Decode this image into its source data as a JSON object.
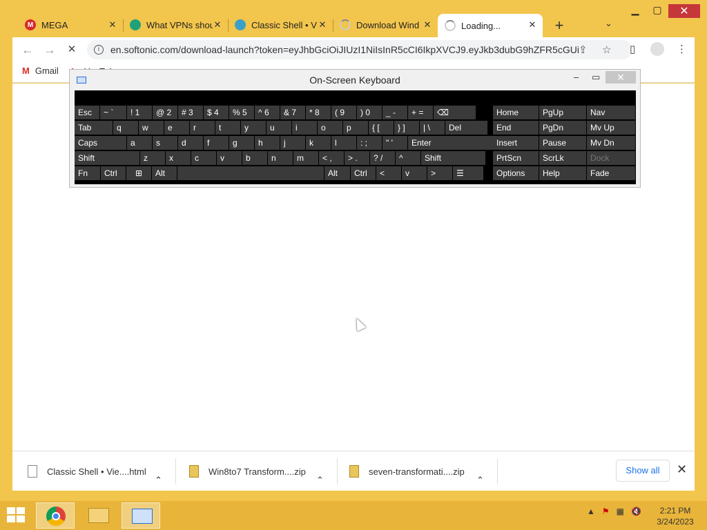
{
  "tabs": [
    {
      "title": "MEGA",
      "favicon": "mega-icon",
      "color": "#d9272e",
      "active": false
    },
    {
      "title": "What VPNs shou",
      "favicon": "vpn-icon",
      "color": "#1fa27a",
      "active": false
    },
    {
      "title": "Classic Shell • V",
      "favicon": "classic-shell-icon",
      "color": "#3aa0c8",
      "active": false
    },
    {
      "title": "Download Wind",
      "favicon": "loading-icon",
      "color": "#bbbbbb",
      "active": false
    },
    {
      "title": "Loading...",
      "favicon": "loading-icon",
      "color": "#bbbbbb",
      "active": true
    }
  ],
  "toolbar": {
    "url": "en.softonic.com/download-launch?token=eyJhbGciOiJIUzI1NiIsInR5cCI6IkpXVCJ9.eyJkb3dubG9hZFR5cGUi...",
    "back_glyph": "←",
    "forward_glyph": "→",
    "stop_glyph": "✕"
  },
  "bookmarks": [
    {
      "label": "Gmail",
      "icon": "gmail-icon"
    },
    {
      "label": "YouTube",
      "icon": "youtube-icon"
    }
  ],
  "osk": {
    "title": "On-Screen Keyboard",
    "rows": [
      [
        "Esc",
        "~ `",
        "! 1",
        "@ 2",
        "# 3",
        "$ 4",
        "% 5",
        "^ 6",
        "& 7",
        "* 8",
        "( 9",
        ") 0",
        "_ -",
        "+ =",
        "⌫"
      ],
      [
        "Tab",
        "q",
        "w",
        "e",
        "r",
        "t",
        "y",
        "u",
        "i",
        "o",
        "p",
        "{ [",
        "} ]",
        "| \\",
        "Del"
      ],
      [
        "Caps",
        "a",
        "s",
        "d",
        "f",
        "g",
        "h",
        "j",
        "k",
        "l",
        ": ;",
        "\" '",
        "Enter"
      ],
      [
        "Shift",
        "z",
        "x",
        "c",
        "v",
        "b",
        "n",
        "m",
        "< ,",
        "> .",
        "? /",
        "^",
        "Shift"
      ],
      [
        "Fn",
        "Ctrl",
        "⊞",
        "Alt",
        "",
        "Alt",
        "Ctrl",
        "<",
        "v",
        ">",
        "☰"
      ]
    ],
    "right_keys": [
      [
        "Home",
        "PgUp",
        "Nav"
      ],
      [
        "End",
        "PgDn",
        "Mv Up"
      ],
      [
        "Insert",
        "Pause",
        "Mv Dn"
      ],
      [
        "PrtScn",
        "ScrLk",
        "Dock"
      ],
      [
        "Options",
        "Help",
        "Fade"
      ]
    ]
  },
  "downloads": [
    {
      "name": "Classic Shell • Vie....html",
      "type": "html"
    },
    {
      "name": "Win8to7 Transform....zip",
      "type": "zip"
    },
    {
      "name": "seven-transformati....zip",
      "type": "zip"
    }
  ],
  "show_all_label": "Show all",
  "clock": {
    "time": "2:21 PM",
    "date": "3/24/2023"
  }
}
